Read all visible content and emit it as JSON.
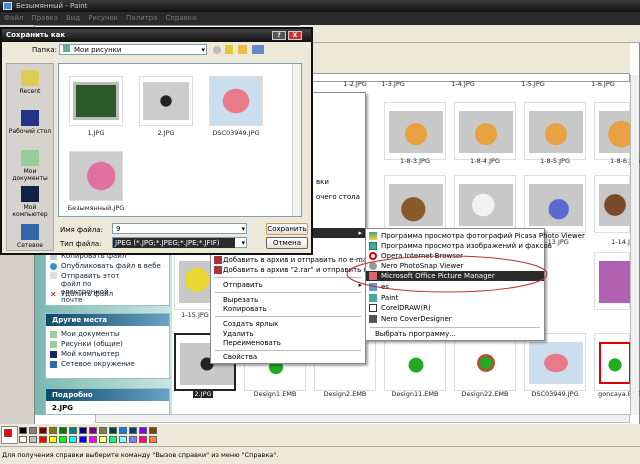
{
  "app": {
    "title": "Безымянный - Paint",
    "menu": [
      "Файл",
      "Правка",
      "Вид",
      "Рисунок",
      "Палитра",
      "Справка"
    ]
  },
  "explorer": {
    "tasks": [
      "Копировать файл",
      "Опубликовать файл в вебе",
      "Отправить этот файл по электронной почте",
      "Удалить файл"
    ],
    "other_places": {
      "title": "Другие места",
      "items": [
        "Мои документы",
        "Рисунки (общие)",
        "Мой компьютер",
        "Сетевое окружение"
      ]
    },
    "details": {
      "title": "Подробно",
      "file": "2.JPG"
    },
    "thumbs_top_labels": [
      "1-2.JPG",
      "1-3.JPG",
      "1-4.JPG",
      "1-5.JPG",
      "1-6.JPG"
    ],
    "thumbs_row1": [
      "1-8-3.JPG",
      "1-8-4.JPG",
      "1-8-5.JPG",
      "1-8-6.JPG"
    ],
    "thumbs_row2": [
      "1-13.JPG",
      "1-14.JPG"
    ],
    "thumbs_row3": [
      "1-15.JPG"
    ],
    "thumbs_row4": [
      "2.JPG",
      "Design1.EMB",
      "Design2.EMB",
      "Design11.EMB",
      "Design22.EMB",
      "DSC03949.JPG",
      "goncaya.EMB"
    ],
    "hidden_menu_fragments": [
      "вки",
      "очего стола"
    ]
  },
  "dialog": {
    "title": "Сохранить как",
    "folder_label": "Папка:",
    "folder_value": "Мои рисунки",
    "places": [
      "Recent",
      "Рабочий стол",
      "Мои документы",
      "Мой компьютер",
      "Сетевое"
    ],
    "files": [
      "1.JPG",
      "2.JPG",
      "DSC03949.JPG",
      "Безымянный.JPG"
    ],
    "filename_label": "Имя файла:",
    "filename_value": "9",
    "filetype_label": "Тип файла:",
    "filetype_value": "JPEG (*.JPG;*.JPEG;*.JPE;*.JFIF)",
    "save": "Сохранить",
    "cancel": "Отмена",
    "help": "?",
    "close": "X"
  },
  "context_menu": {
    "items": [
      "Добавить в архив и отправить по e-mail...",
      "Добавить в архив \"2.rar\" и отправить по e-mail",
      "Отправить",
      "Вырезать",
      "Копировать",
      "Создать ярлык",
      "Удалить",
      "Переименовать",
      "Свойства"
    ]
  },
  "open_with": {
    "items": [
      "Программа просмотра фотографий Picasa Photo Viewer",
      "Программа просмотра изображений и факсов",
      "Opera Internet Browser",
      "Nero PhotoSnap Viewer",
      "Microsoft Office Picture Manager",
      "es",
      "Paint",
      "CorelDRAW(R)",
      "Nero CoverDesigner"
    ],
    "choose": "Выбрать программу...",
    "highlighted": "Microsoft Office Picture Manager",
    "annotation_color": "#c03030"
  },
  "palette": {
    "primary": "#ff0000",
    "secondary": "#ffffff",
    "top": [
      "#000000",
      "#808080",
      "#800000",
      "#808000",
      "#008000",
      "#008080",
      "#000080",
      "#800080",
      "#808040",
      "#004040",
      "#0080ff",
      "#004080",
      "#8000ff",
      "#804000"
    ],
    "bottom": [
      "#ffffff",
      "#c0c0c0",
      "#ff0000",
      "#ffff00",
      "#00ff00",
      "#00ffff",
      "#0000ff",
      "#ff00ff",
      "#ffff80",
      "#00ff80",
      "#80ffff",
      "#8080ff",
      "#ff0080",
      "#ff8040"
    ]
  },
  "status": "Для получения справки выберите команду \"Вызов справки\" из меню \"Справка\"."
}
